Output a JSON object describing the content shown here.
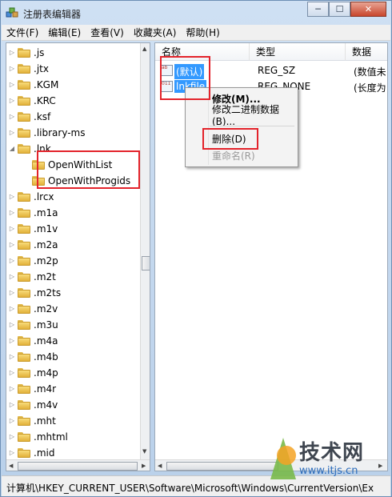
{
  "window": {
    "title": "注册表编辑器",
    "minimize": "─",
    "maximize": "☐",
    "close": "✕"
  },
  "menu": [
    "文件(F)",
    "编辑(E)",
    "查看(V)",
    "收藏夹(A)",
    "帮助(H)"
  ],
  "tree": {
    "items": [
      {
        "label": ".js",
        "expanded": false
      },
      {
        "label": ".jtx",
        "expanded": false
      },
      {
        "label": ".KGM",
        "expanded": false
      },
      {
        "label": ".KRC",
        "expanded": false
      },
      {
        "label": ".ksf",
        "expanded": false
      },
      {
        "label": ".library-ms",
        "expanded": false
      },
      {
        "label": ".lnk",
        "expanded": true
      },
      {
        "label": "OpenWithList",
        "child": true
      },
      {
        "label": "OpenWithProgids",
        "child": true
      },
      {
        "label": ".lrcx",
        "expanded": false
      },
      {
        "label": ".m1a",
        "expanded": false
      },
      {
        "label": ".m1v",
        "expanded": false
      },
      {
        "label": ".m2a",
        "expanded": false
      },
      {
        "label": ".m2p",
        "expanded": false
      },
      {
        "label": ".m2t",
        "expanded": false
      },
      {
        "label": ".m2ts",
        "expanded": false
      },
      {
        "label": ".m2v",
        "expanded": false
      },
      {
        "label": ".m3u",
        "expanded": false
      },
      {
        "label": ".m4a",
        "expanded": false
      },
      {
        "label": ".m4b",
        "expanded": false
      },
      {
        "label": ".m4p",
        "expanded": false
      },
      {
        "label": ".m4r",
        "expanded": false
      },
      {
        "label": ".m4v",
        "expanded": false
      },
      {
        "label": ".mht",
        "expanded": false
      },
      {
        "label": ".mhtml",
        "expanded": false
      },
      {
        "label": ".mid",
        "expanded": false
      }
    ]
  },
  "list": {
    "columns": [
      "名称",
      "类型",
      "数据"
    ],
    "rows": [
      {
        "name": "(默认)",
        "type": "REG_SZ",
        "data": "(数值未",
        "icon": "ab"
      },
      {
        "name": "lnkfile",
        "type": "REG_NONE",
        "data": "(长度为",
        "icon": "011"
      }
    ]
  },
  "context_menu": {
    "items": [
      "修改(M)...",
      "修改二进制数据(B)...",
      "删除(D)",
      "重命名(R)"
    ]
  },
  "status": {
    "path": "计算机\\HKEY_CURRENT_USER\\Software\\Microsoft\\Windows\\CurrentVersion\\Ex"
  },
  "watermark": {
    "title": "技术网",
    "url": "www.itjs.cn"
  },
  "colors": {
    "highlight": "#e3232b",
    "selection": "#3399ff"
  }
}
